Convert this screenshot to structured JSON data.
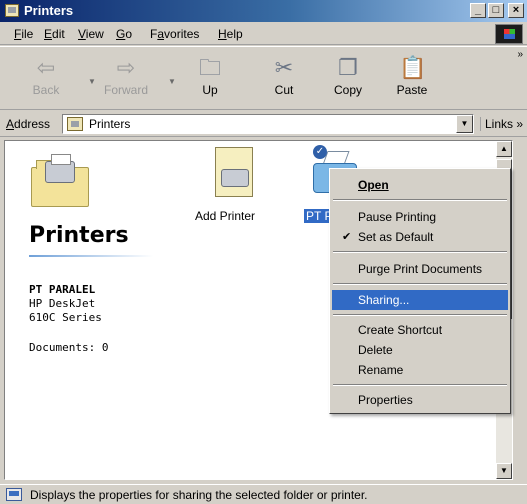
{
  "window": {
    "title": "Printers",
    "minimize": "_",
    "restore": "□",
    "close": "×"
  },
  "menu": [
    {
      "label": "File",
      "u": "F"
    },
    {
      "label": "Edit",
      "u": "E"
    },
    {
      "label": "View",
      "u": "V"
    },
    {
      "label": "Go",
      "u": "G"
    },
    {
      "label": "Favorites",
      "u": "a"
    },
    {
      "label": "Help",
      "u": "H"
    }
  ],
  "menu_labels": {
    "file_rest": "ile",
    "edit_rest": "dit",
    "view_rest": "iew",
    "go_rest": "o",
    "fav_pre": "F",
    "fav_rest": "vorites",
    "help_rest": "elp"
  },
  "toolbar": {
    "back": "Back",
    "forward": "Forward",
    "up": "Up",
    "cut": "Cut",
    "copy": "Copy",
    "paste": "Paste"
  },
  "address": {
    "label_u": "A",
    "label_rest": "ddress",
    "value": "Printers",
    "links": "Links"
  },
  "left_pane": {
    "title": "Printers",
    "printer_name": "PT PARALEL",
    "printer_desc_line1": "HP DeskJet",
    "printer_desc_line2": "610C Series",
    "documents": "Documents: 0"
  },
  "icons": {
    "add_printer": "Add Printer",
    "pt_printer": "PT P"
  },
  "context_menu": {
    "open": "Open",
    "pause": "Pause Printing",
    "default": "Set as Default",
    "purge": "Purge Print Documents",
    "sharing": "Sharing...",
    "shortcut": "Create Shortcut",
    "delete": "Delete",
    "rename": "Rename",
    "properties": "Properties"
  },
  "status": {
    "text": "Displays the properties for sharing the selected folder or printer."
  },
  "colors": {
    "selection": "#316ac5",
    "titlebar": "#0a246a",
    "face": "#d4d0c8"
  }
}
